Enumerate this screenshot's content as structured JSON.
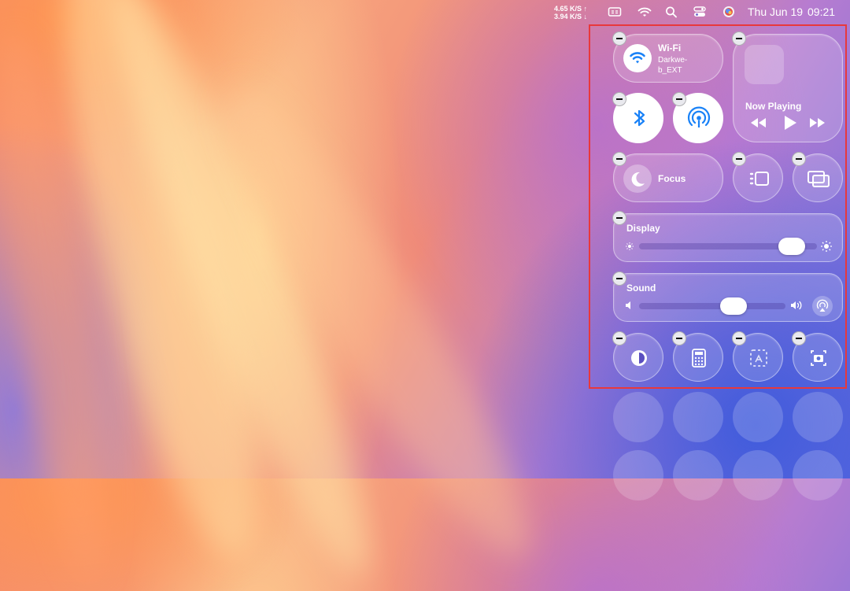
{
  "menubar": {
    "net_up": "4.65 K/S ↑",
    "net_down": "3.94 K/S ↓",
    "date": "Thu Jun 19",
    "time": "09:21",
    "icons": [
      "display-icon",
      "wifi-icon",
      "search-icon",
      "control-center-icon",
      "siri-icon"
    ]
  },
  "control_center": {
    "wifi": {
      "title": "Wi-Fi",
      "network": "Darkwe-b_EXT"
    },
    "now_playing": {
      "title": "Now Playing"
    },
    "focus": {
      "label": "Focus"
    },
    "display": {
      "label": "Display",
      "brightness": 0.92
    },
    "sound": {
      "label": "Sound",
      "volume": 0.68
    },
    "toggles": [
      "bluetooth-icon",
      "airdrop-icon",
      "stage-manager-icon",
      "screen-mirroring-icon"
    ],
    "bottom_row": [
      "dark-mode-icon",
      "calculator-icon",
      "screenshot-selection-icon",
      "screenshot-camera-icon"
    ]
  },
  "colors": {
    "highlight_border": "#e8383c",
    "accent_blue": "#1a82f7"
  }
}
